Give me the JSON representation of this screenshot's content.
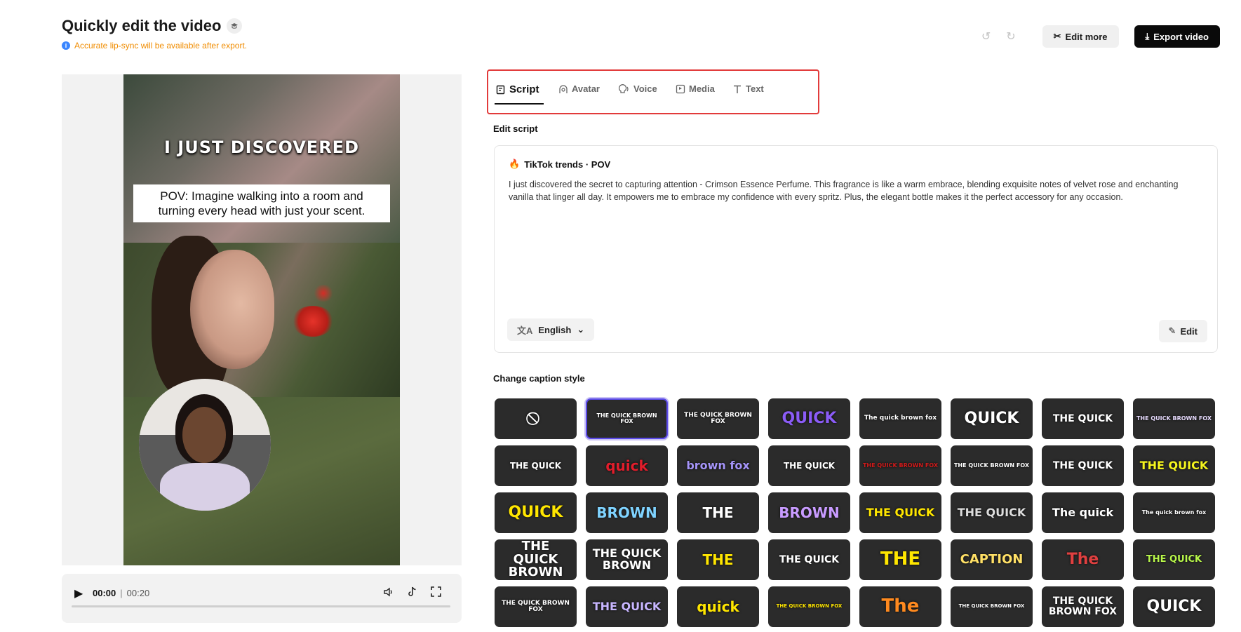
{
  "header": {
    "title": "Quickly edit the video",
    "notice": "Accurate lip-sync will be available after export.",
    "edit_more": "Edit more",
    "export_video": "Export video"
  },
  "preview": {
    "caption_headline": "I JUST DISCOVERED",
    "caption_box": "POV: Imagine walking into a room and turning every head with just your scent."
  },
  "player": {
    "current_time": "00:00",
    "duration": "00:20",
    "progress": 0
  },
  "tabs": [
    {
      "label": "Script",
      "icon": "script-icon",
      "active": true
    },
    {
      "label": "Avatar",
      "icon": "avatar-icon",
      "active": false
    },
    {
      "label": "Voice",
      "icon": "voice-icon",
      "active": false
    },
    {
      "label": "Media",
      "icon": "media-icon",
      "active": false
    },
    {
      "label": "Text",
      "icon": "text-icon",
      "active": false
    }
  ],
  "script": {
    "section_label": "Edit script",
    "tag": "TikTok trends · POV",
    "text": "I just discovered the secret to capturing attention - Crimson Essence Perfume. This fragrance is like a warm embrace, blending exquisite notes of velvet rose and enchanting vanilla that linger all day. It empowers me to embrace my confidence with every spritz. Plus, the elegant bottle makes it the perfect accessory for any occasion.",
    "language": "English",
    "edit_label": "Edit"
  },
  "captions": {
    "section_label": "Change caption style",
    "styles": [
      {
        "text": "⃠",
        "color": "#ffffff",
        "bg": "#2b2b2b",
        "size": 18
      },
      {
        "text": "THE QUICK BROWN FOX",
        "color": "#ffffff",
        "bg": "#2b2b2b",
        "size": 8,
        "selected": true
      },
      {
        "text": "THE QUICK BROWN FOX",
        "color": "#ffffff",
        "bg": "#2b2b2b",
        "size": 9
      },
      {
        "text": "QUICK",
        "color": "#8b5cf6",
        "bg": "#2b2b2b",
        "size": 22
      },
      {
        "text": "The quick brown fox",
        "color": "#ffffff",
        "bg": "#2b2b2b",
        "size": 9
      },
      {
        "text": "QUICK",
        "color": "#ffffff",
        "bg": "#2b2b2b",
        "size": 22
      },
      {
        "text": "THE QUICK",
        "color": "#ffffff",
        "bg": "#2b2b2b",
        "size": 14
      },
      {
        "text": "THE QUICK BROWN FOX",
        "color": "#e8dcff",
        "bg": "#2b2b2b",
        "size": 8
      },
      {
        "text": "THE QUICK",
        "color": "#ffffff",
        "bg": "#2b2b2b",
        "size": 12
      },
      {
        "text": "quick",
        "color": "#e11d2b",
        "bg": "#2b2b2b",
        "size": 20
      },
      {
        "text": "brown fox",
        "color": "#a594f9",
        "bg": "#2b2b2b",
        "size": 16
      },
      {
        "text": "THE QUICK",
        "color": "#ffffff",
        "bg": "#2b2b2b",
        "size": 12
      },
      {
        "text": "THE QUICK BROWN FOX",
        "color": "#d11a1a",
        "bg": "#2b2b2b",
        "size": 8
      },
      {
        "text": "THE QUICK BROWN FOX",
        "color": "#ffffff",
        "bg": "#2b2b2b",
        "size": 8
      },
      {
        "text": "THE QUICK",
        "color": "#ffffff",
        "bg": "#2b2b2b",
        "size": 14
      },
      {
        "text": "THE QUICK",
        "color": "#f5f51e",
        "bg": "#2b2b2b",
        "size": 16
      },
      {
        "text": "QUICK",
        "color": "#ffe600",
        "bg": "#2b2b2b",
        "size": 22
      },
      {
        "text": "BROWN",
        "color": "#7fd3ff",
        "bg": "#2b2b2b",
        "size": 20
      },
      {
        "text": "THE",
        "color": "#ffffff",
        "bg": "#2b2b2b",
        "size": 20
      },
      {
        "text": "BROWN",
        "color": "#c89bff",
        "bg": "#2b2b2b",
        "size": 20
      },
      {
        "text": "THE QUICK",
        "color": "#ffe600",
        "bg": "#2b2b2b",
        "size": 16
      },
      {
        "text": "THE QUICK",
        "color": "#dddddd",
        "bg": "#2b2b2b",
        "size": 16
      },
      {
        "text": "The quick",
        "color": "#ffffff",
        "bg": "#2b2b2b",
        "size": 16
      },
      {
        "text": "The quick brown fox",
        "color": "#ffffff",
        "bg": "#2b2b2b",
        "size": 8
      },
      {
        "text": "THE QUICK BROWN",
        "color": "#ffffff",
        "bg": "#2b2b2b",
        "size": 18
      },
      {
        "text": "THE QUICK BROWN",
        "color": "#ffffff",
        "bg": "#2b2b2b",
        "size": 16
      },
      {
        "text": "THE",
        "color": "#ffe600",
        "bg": "#2b2b2b",
        "size": 20
      },
      {
        "text": "THE QUICK",
        "color": "#ffffff",
        "bg": "#2b2b2b",
        "size": 14
      },
      {
        "text": "THE",
        "color": "#ffe600",
        "bg": "#2b2b2b",
        "size": 26
      },
      {
        "text": "CAPTION",
        "color": "#ffe066",
        "bg": "#2b2b2b",
        "size": 18
      },
      {
        "text": "The",
        "color": "#e04040",
        "bg": "#2b2b2b",
        "size": 22
      },
      {
        "text": "THE QUICK",
        "color": "#b8f74a",
        "bg": "#2b2b2b",
        "size": 13
      },
      {
        "text": "THE QUICK BROWN FOX",
        "color": "#ffffff",
        "bg": "#2b2b2b",
        "size": 9
      },
      {
        "text": "THE QUICK",
        "color": "#c8b6ff",
        "bg": "#2b2b2b",
        "size": 16
      },
      {
        "text": "quick",
        "color": "#ffe600",
        "bg": "#2b2b2b",
        "size": 20
      },
      {
        "text": "THE QUICK BROWN FOX",
        "color": "#ffe600",
        "bg": "#2b2b2b",
        "size": 7
      },
      {
        "text": "The",
        "color": "#ff8a1f",
        "bg": "#2b2b2b",
        "size": 26
      },
      {
        "text": "THE QUICK BROWN FOX",
        "color": "#ffffff",
        "bg": "#2b2b2b",
        "size": 7
      },
      {
        "text": "THE QUICK BROWN FOX",
        "color": "#ffffff",
        "bg": "#2b2b2b",
        "size": 14
      },
      {
        "text": "QUICK",
        "color": "#ffffff",
        "bg": "#2b2b2b",
        "size": 22
      }
    ]
  }
}
